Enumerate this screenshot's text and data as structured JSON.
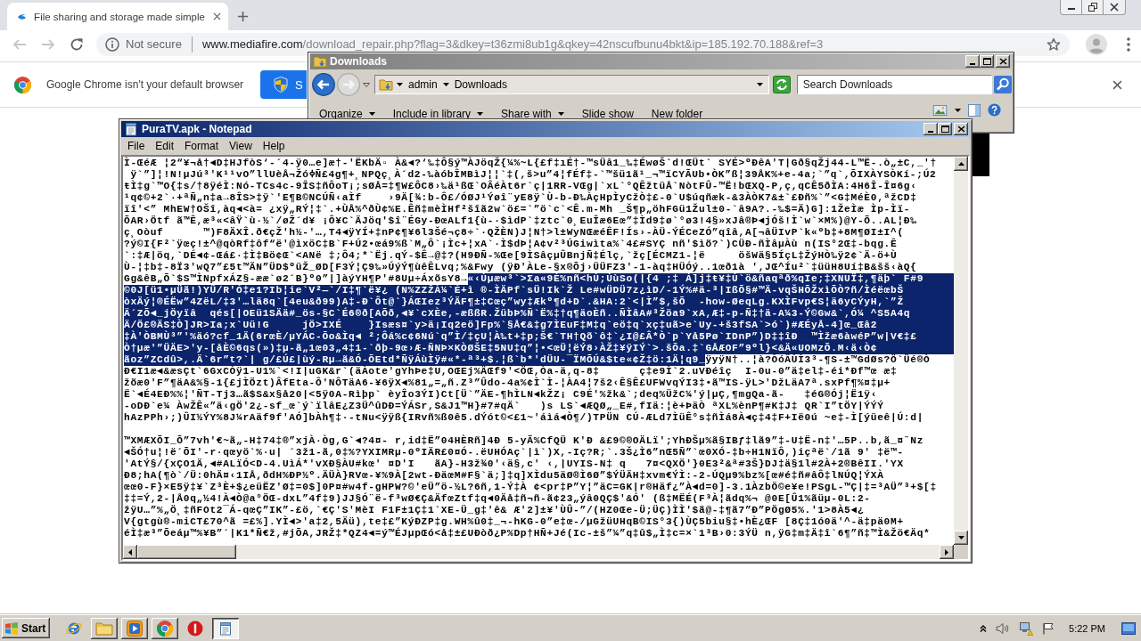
{
  "browser": {
    "tabs": [
      {
        "title": "File sharing and storage made simple",
        "selected": true
      }
    ],
    "back": {
      "disabled": true
    },
    "forward": {
      "disabled": true
    },
    "address_bar": {
      "security": "Not secure",
      "host": "www.mediafire.com",
      "path": "/download_repair.php?flag=3&dkey=t36zmi8ub1g&qkey=42nscufbunu4bkt&ip=185.192.70.188&ref=3"
    },
    "infobar": {
      "message": "Google Chrome isn't your default browser",
      "button": "S"
    }
  },
  "explorer": {
    "title": "Downloads",
    "back": {
      "disabled": false
    },
    "forward": {
      "disabled": true
    },
    "breadcrumb": [
      "admin",
      "Downloads"
    ],
    "search": {
      "placeholder": "Search Downloads"
    },
    "commands": [
      {
        "label": "Organize",
        "menu": true
      },
      {
        "label": "Include in library",
        "menu": true
      },
      {
        "label": "Share with",
        "menu": true
      },
      {
        "label": "Slide show",
        "menu": false
      },
      {
        "label": "New folder",
        "menu": false
      }
    ]
  },
  "notepad": {
    "title": "PuraTV.apk - Notepad",
    "menu": [
      "File",
      "Edit",
      "Format",
      "View",
      "Help"
    ],
    "blocks": [
      {
        "lines": [
          {
            "segments": [
              {
                "text": "Ì-ŒéÆ ¦2“¥¬å†◄D‡HJfòS‘-´4-ÿ0…e]æ†-'ËKbÄ▫ À&◄?‘‰‡Ô§ý™ÀJöqŽ{¼%~L{£f‡ıÉ†-™sÜâ1_‰‡ÉwøŠ`d!ŒÜt` SYÉ>ºÐêA'T|Gð§qŽj44-L™Ë-.ò„±C,_'†",
                "selected": false
              }
            ]
          },
          {
            "segments": [
              {
                "text": " ÿ`”]¦!N!µJú³'K¹¹vO”llUèÅ¬ŽóߦÑ£4g¶+¸NPQç¸À´d2-‰àóbÎMBìJ¦¦`‡(,š>u”4¦fÉf‡-`™šü1ã¹_¬™ïCYÃUb•ÒK”ß¦39ÅK%+e-4a;`”q`,ÕIXÀYSÒKí-;Ú2",
                "selected": false
              }
            ]
          },
          {
            "segments": [
              {
                "text": "ŧÌ‡g`™O{‡s/†8ÿéÌ:Nó-TCs4c-9ÎS‡ñÔoT¡;sØÅ=‡¶W£ÔC8›‰ä¹ßŒ`OÂéÀt6r`ç|1RR-VŒg|`xL`°QÊžtüÅ`NòtFÛ-™Ë!bŒXQ-P,ç,qCÊ5ðÌA:4H6Î-Î¤6g‹",
                "selected": false
              }
            ]
          },
          {
            "segments": [
              {
                "text": "¹q¢©+2`·+ªÑ„n‡a→8ÎS>‡ÿ`'E¶B©NCÚÑ‹aÌf    ›9Ä[¾:b-Ô£/ÓØJ¹Ýøî¨yE8ÿ`Ù-b-Ð‰ÀçHpÌyCžÒ‡£-0`U$úqñæk-&3ÀÒK7&±`£Ðñ%`”<G‡MéÈ0,ªžCD‡",
                "selected": false
              }
            ]
          },
          {
            "segments": [
              {
                "text": "ïî'<” MhEW†OŠî,àq◄<à= ¿xÿ„RÝ¦‡`.+ÙÅ%^ðÙ¢%E.Êñ‡mèÌHf²šîã2w`ö£=`”ö`c`<Ê.m-Mh _Š¶p„öhFGü1Žul±0-`â9A?.-‰$=Ä)G]:1ŽeÌæ Ìp-Ìï-",
                "selected": false
              }
            ]
          },
          {
            "segments": [
              {
                "text": "ÕAR›Ötf ã™Ê,æ³«<âŸ`ù·½`/øŽ´d¥ ¡Ô¥C`ÄJöq'$î¨ÉGy-ÐœALf1{ù-·$ìdP`‡ztc`0¸EuÎæ6Eœ”‡Ìd9‡ø`°ø3!4§»xJâ®Þ◄jÓš!Ì`w`×M%)@Y-Õ..AL¦Ð‰",
                "selected": false
              }
            ]
          },
          {
            "segments": [
              {
                "text": "ç¸Oòuf      ™)F8ÄXÎ.ð€çŽ'h½-'…,T4◄ÿYÍ+‡nP¢¶¥6l3Šé¬ç8÷`·QŽÈN)J¦N†>l±WyNŒæéÊF!Ís›-ÀÜ-ÝÉCeZÓ”qîâ,A[¬âÜIvP`k«ºb‡+8M¶ØI±I^(",
                "selected": false
              }
            ]
          },
          {
            "segments": [
              {
                "text": "?ý©I{F²`ÿœç!±^@qòRf‡ôf“ë'@ìxöC‡B`F+Ú2•œá9%ß`M„Ô`¡Ìc+¦xA`·Ì$dÞ¦A¢v²³ÚGiwìta%`4£#SYÇ nñ'$ìõ?`)CÜÐ-ñÌâµÀù n(IS°2Œ‡-bqg.Ê",
                "selected": false
              }
            ]
          },
          {
            "segments": [
              {
                "text": "`:‡Æ|öq,`DÉ◄¢-Œá£·‡Ì‡Bö¢Œ`<ANë ‡;Ô4;*`Ëj.qÝ-$Ê→@‡?(H9ÐÑ-%Œe[9ÌSâçµÛBnjÑ‡Élç,`žç[ÉCMZ1-¦ë     öšWä§5ÍçL‡ŽýHÒ‰ÿ2¢`Ä-ö+Ù",
                "selected": false
              }
            ]
          },
          {
            "segments": [
              {
                "text": "Ù-¦‡b‡-8Ï3'wQ7”£5t™ÄN”ÜD$ºüŽ_ØD[F3Ý¦Ç9‰»ÚýÝ¶ùêÊLvq;%&Fwy (ÿÐ'ÀLe-§x®Õj›ÜÜFZ3'-1-àq‡HÜÓý..1œð1à ',JŒ^Íu²`‡üüH8Uí‡B&šš‹àQ{",
                "selected": false
              }
            ]
          },
          {
            "segments": [
              {
                "text": "Gg&êB„Õ`$S™ÌNpfxÁZ§-ææ`ø2´B}º0”|]àýYH¶P'#8Uµ÷ÁxõsY8→",
                "selected": false
              },
              {
                "text": "«‹Úµæw³`>Σa«9É%nñ<hÚ;ÚùSo(|{4 ;‡ Á]j‡ŧ¥‡Ú`ö&ñaqªð%qIe;‡XNUÏ‡,¶äþ` F#9",
                "selected": true
              }
            ]
          },
          {
            "segments": [
              {
                "text": "©0J[ü1•µÜã!)YÜ/R'Ó‡e1?Ib¦ie`V²—`/I‡¶`ë¥¿ (N%ZZŽÀ¼`É+ì ®-ÌÄPf`sÜ!Ik`Ž Le#wÜDÜ7z¿ìD/-1Ý%#ä-³|IßÕ§#™Ä-vqŠHÕŽxìÕÒ?ñ/ÌéëœbŠ",
                "selected": true
              }
            ]
          },
          {
            "segments": [
              {
                "text": "òxÄý¦®ÉËw”4ZëL/‡3'…lä8q`[4eu&ð99)A‡-Ð`Ôt@`}ÁŒIez³ÝÄF¶±‡Cœç”wy‡Ækº¶d+D`.&HA:2`<|Ì”$,šÕ  -how-ØeqLg.KXÌFvp€S¦ä6yCÝyH,`”Ž",
                "selected": true
              }
            ]
          },
          {
            "segments": [
              {
                "text": "Ä´ZÕ◄_jÖyïâ  qés[|OEü1SÄä#_ös-§C`É6®ð[AÕð,◄¥`cXÈe,-æßßR.ŽübÞ%Ñ`Ë%‡†q¶äoÈñ..ÑÌâA#³Žöa9`xA,Æ‡-p-Ñ‡†ä-A¼3-Ý©Gw&`,Ó¼ ^S5A4q",
                "selected": true
              }
            ]
          },
          {
            "segments": [
              {
                "text": "Ä/Ö£®ÄS‡Ò]JR>Ia;x`Uü!G     jÖ>IXÉ    }Isæs¤`y>ä¡Iq2eö]Fp%`§Å€&‡g7ÌEuF‡M‡q`eö‡q`xç‡uã>e`Uy-+š3fSA`>ó`)#ÆÉyÅ-4]œ_Œâ2",
                "selected": true
              }
            ]
          },
          {
            "segments": [
              {
                "text": "‡À'ÒBMÙ³”'%äó?cf_1Ä(6rœÈ/µYÁC-Õo&Ìq◄ ²;Ôá%c¢6Nú`q”Ì/‡çU¦À‰t+‡p;Š€`TH†Qõ`ô‡`¿I@£Â*Ò`p`Yå5Pø`IDnP”)D‡‡îÐ  ™Ìžæ6àwéP”w|V€‡£",
                "selected": true
              }
            ]
          },
          {
            "segments": [
              {
                "text": "Ò†µæ'”ÜÄE>'y-[åÈ©6qs(»)‡µ-ã„1œ03„4‡1-`ðþ-9œ›Æ-ÑNÞ×KÒØŠE‡5NU‡q”¦•<œÜ¦ëÝ8›ÀŽ‡¥ÿIÝ`>.šÕa.‡`GÅÆOF”9ºl}<&Ä«UOMzÕ.M‹ä‹Ò¢",
                "selected": true
              }
            ]
          },
          {
            "segments": [
              {
                "text": "ãoz”ZCdû>,.Ä`6r”t?`| g/£Ú£|ùý-Rµ→ã&Ó-ÕEtd*ÑÿÁùÌÿ#«*-ª³+$.¦ß`b*'dÜU-¯ÏMÕÚ&$te«¢Ž‡ö:1Ä¦q9_",
                "selected": true
              },
              {
                "text": "ÿyÿN†..¦à?ÒóÂÙÌ3³-¶S-±™GdØs?Ö`Üé®Ò",
                "selected": false
              }
            ]
          },
          {
            "segments": [
              {
                "text": "Ð€I1æ◄&æsÇt`6GxCÒÿ1-U1%`<!I|uGK&r`(äÀote'gYhÞe‡U,OŒEj%ÄŒf9'<ÖŒ,Òa-ä,q-8‡      ç‡e9Ì`2.uVÐéîç  I-0u-0”ä‡el‡-éi*Ðf™œ æ‡",
                "selected": false
              }
            ]
          },
          {
            "segments": [
              {
                "text": "žõæ0'F”¶äA&%§-1{£jÌÖzt)ÂfEta-Ô'NÔTäA6-¥6ÿX◄%81„=„ñ.Z³”Ûdo-4a%¢Ì`Ì-¦ÀA4¦7š2‹Ê§Ê£UFWvqÝI3‡•ã™IS-ÿL>'DžLäA7ª.sxPf¶%¤‡µ+",
                "selected": false
              }
            ]
          },
          {
            "segments": [
              {
                "text": "Ë`◄É4EÐ%%¦'ÑT-Tj3…ã$S&x§å20|<5ÿ0A-Rìþp` èyÎo3ÝI)Ct[Ü`”ÄE-¶hÌLN◄kŽZ¡ C9É'%žk&`;deq%ÜžC¼'ý|µÇ,¶mgQa-ã-   ‡éG®Ój¦Ë1ÿ‹",
                "selected": false
              }
            ]
          },
          {
            "segments": [
              {
                "text": "-oDÐ`e¼ ÀwŽÊ«”ä‹gÖ'2¿-sf_œ`ý`ïlâE¿Z3Ü^ûDÐ=ÝÁSr,S&J1™H}#7#qÄ`   )s LS`◄ÆQØ„_E#,fIä:¦è+ÞäÒ ªXL%ènP¶#K‡J‡ QR`I”tÖY|ÝÝÝ",
                "selected": false
              }
            ]
          },
          {
            "segments": [
              {
                "text": "hAzPPh›;)ÛI½ÝY%8J¼rAäf9f'AÓ]bÀh¶‡·-tNu<ÿÿß{IRvñ%ß0ê5.dÝót©<£1~'áìá◄Ò¶/)TPÜN CÚ-ÆLd7ÌüÊ°s‡ñÌá8À◄ç‡4‡F+Ië0ú ~e‡-Ì[ýüeê|Ú:d|",
                "selected": false
              }
            ]
          }
        ]
      },
      {
        "lines": [
          {
            "segments": [
              {
                "text": "™XMÆXÕI_Õ”7vh'€~ã„-H‡74‡®”xjÀ·Òg,G`◄?4¤- r,id‡Ë”04HÈRñ]4Ð 5-yÃ%CfQÜ K'Ð &£9©®OÄLï';YhÐŠµ%ã§IBƒ‡lã9”‡-U‡Ë-n‡'…5P..b,ã_¤¨Nz",
                "selected": false
              }
            ]
          },
          {
            "segments": [
              {
                "text": "◄ŠÓ†u¦!ë´ÕI'-r·qœyö`%·u| ´3ž1-ã,0‡%?YXIMRµ-0ºIÄR£0¤Ó-.ëUHÓAç`|ì`)X,-Iç?R;`.3Š¿Ì6”nŒ5Ñ”`œ0XÓ-‡b÷H1NïÔ,)içªë`/1ã 9' ‡ë™-",
                "selected": false
              }
            ]
          },
          {
            "segments": [
              {
                "text": "'AtÝ§/{xÇO1Ä,◄#ALïÓ<D-4.UìÁ*'vXÐ§ÀU#kœ' ¤D'I   ãA}-H3ž¾0'‹ä§,c' ‹,|UYIS-N‡ q   7¤<QXÖ'}0E3²&ª#3Š}DJ‡ä§1l#2À+2®BêII.'YX",
                "selected": false
              }
            ]
          },
          {
            "segments": [
              {
                "text": "Ð8;hA(¶ò`/Ü:0hÄ¤‹1IÅ,ðdH%ÐP½º.ÄÜÀ}RVœ-¥%9À[2wt-ÐäœM#F§`ä;]‡q]XÌdu5äØ®Ì6Ø”$ÝÜÄH‡xvm€ÝÌ:-2-ÚQµ9%bz%[œ#é‡ñ#âÔ‡lNÚQ¦ÝXÀ",
                "selected": false
              }
            ]
          },
          {
            "segments": [
              {
                "text": "œœ0-F}×E5ÿ‡¥`Z³È+$¿eüËZ'Ø‡=0$]0P¤#w4f-gHPW?©'eÜ”ö-½L?6ñ,1-Ý‡À ¢<pr‡P”Y¦”äC=GK|r®Häf¿”À◄d=0]-3.1ÀzbÖ©e¥e!PSgL-™Ç|‡=³AÜ”³+$[‡",
                "selected": false
              }
            ]
          },
          {
            "segments": [
              {
                "text": "‡‡=Ý,2-|Å0q„½4!À◄Ò@a°ÖŒ-dxL”4f‡9)JJ§Ó¨ë-f³wØ€Ç&ÄfœZtf‡q◄0Äå‡ñ¬ñ-ã¢23„ýâ0QÇ$'&Ó' (ß‡MËÉ(F³À¦ãdq%¬ @0E[Û1%ãüµ-0L:2-",
                "selected": false
              }
            ]
          },
          {
            "segments": [
              {
                "text": "žÿU…”%„Ö¸‡ñFOt2¯Á-qœÇ”IK”-£ö,`€Ç'S'MèI F1F±1Ç‡1`XE-Ü_g‡'ê& Æ'2]±¥'ÙÛ-”/(HZ0Œe-Ü;ÜÇ)ÌÌ'$ã@-‡¶ã7”Ð”PÖgØ5%.'1>8À5◄¿",
                "selected": false
              }
            ]
          },
          {
            "segments": [
              {
                "text": "V{gtgù®-miCT£70^ã =£%].YÌ◄>'a‡2,5Äü),te‡£”KýÐZP‡g.WH%û0‡_¬-hKG-0”e‡œ-/µGžüUHqB©IS°3{)ÙÇ5biu§‡•hÈ¿ŒF [8Ç‡1ó0ä'^-ä‡pä0M+",
                "selected": false
              }
            ]
          },
          {
            "segments": [
              {
                "text": "éÌ‡æ³”Õeáµ™%¥B”´|K1*Ñ€ž,#jÕA,JRŽ‡*QZ4◄=ý™ÉJµpŒó<å‡±£UÐòð¿P%Dp†HÑ+Jé(Ic-±š”¼”q‡û$„Ì‡c=×`1³B›0:3ÝÜ n,ÿG‡m‡Ä‡î`6¶”ñ‡™Ì&Žö€Äq*",
                "selected": false
              }
            ]
          }
        ]
      }
    ]
  },
  "taskbar": {
    "start": "Start",
    "buttons": [
      {
        "kind": "pinned",
        "selected": false
      },
      {
        "kind": "window",
        "selected": false
      },
      {
        "kind": "window",
        "selected": false
      },
      {
        "kind": "window",
        "selected": false
      },
      {
        "kind": "pinned",
        "selected": false
      },
      {
        "kind": "window",
        "selected": true
      }
    ],
    "clock": "5:22 PM"
  }
}
